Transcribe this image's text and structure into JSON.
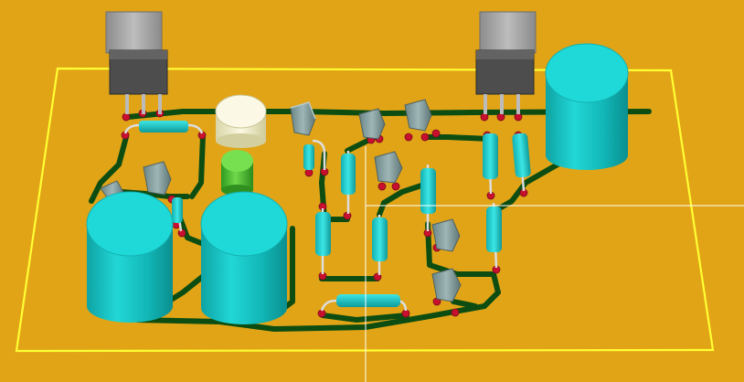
{
  "viewer": {
    "background": "#e1a417",
    "board_outline_color": "#ffff33",
    "trace_color": "#0d4d12",
    "cursor_color": "#ffffff"
  },
  "components": {
    "regulators": [
      {
        "name": "left-regulator",
        "body_color": "#4d4d4d",
        "tab_color": "#9a9a9a"
      },
      {
        "name": "right-regulator",
        "body_color": "#4d4d4d",
        "tab_color": "#9a9a9a"
      }
    ],
    "electrolytic_capacitors": [
      {
        "name": "left-capacitor",
        "color": "#19c6c6"
      },
      {
        "name": "center-capacitor",
        "color": "#19c6c6"
      },
      {
        "name": "right-capacitor",
        "color": "#19c6c6"
      }
    ],
    "transistors": {
      "count": 8,
      "color": "#7f9a9b"
    },
    "resistors": {
      "count": 10,
      "color": "#19c6c6"
    },
    "led": {
      "color": "#3fb02a"
    },
    "potentiometer": {
      "color": "#f3f0cc"
    },
    "pads": {
      "ring_color": "#c8102e",
      "drill_color": "#e6e6e6"
    }
  }
}
